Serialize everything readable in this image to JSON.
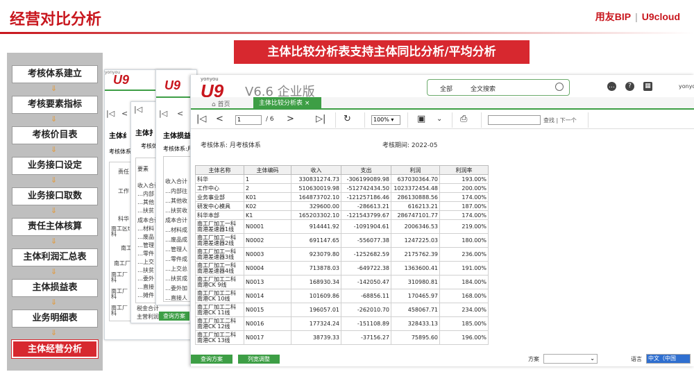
{
  "slide": {
    "title": "经营对比分析",
    "brand_left": "用友BIP",
    "brand_sep": "|",
    "brand_right": "U9cloud",
    "banner": "主体比较分析表支持主体同比分析/平均分析"
  },
  "process_steps": [
    "考核体系建立",
    "考核要素指标",
    "考核价目表",
    "业务接口设定",
    "业务接口取数",
    "责任主体核算",
    "主体利润汇总表",
    "主体损益表",
    "业务明细表",
    "主体经营分析"
  ],
  "arrow_glyph": "⇓",
  "bg_windows": {
    "w1": {
      "title_trunc": "主体纟",
      "sys_trunc": "考核体系",
      "label": "责任",
      "rows": [
        "工作",
        "科华",
        "南工区t\n科",
        "南工",
        "南工厂",
        "南工厂\n科",
        "南工厂\n科",
        "南工厂\n科"
      ]
    },
    "w2": {
      "title_trunc": "主体扌",
      "sys_trunc": "考核体",
      "label": "要素",
      "rows": [
        "收入合计",
        "…内部",
        "…其他",
        "…扶贫",
        "成本合计",
        "…材料",
        "…废品",
        "…管理",
        "…零件",
        "…上交",
        "…扶贫",
        "…委外",
        "…直接",
        "…摊件",
        "税金合计",
        "主营利润"
      ],
      "btn": "查询方案"
    },
    "w3": {
      "title_trunc": "主体损益",
      "sys_trunc": "考核体系:月",
      "rows": [
        "收入合计",
        "…内部往",
        "…其他收",
        "…扶贫收",
        "成本合计",
        "…材料成",
        "…废品成",
        "…管理人",
        "…零件成",
        "…上交总",
        "…扶贫成",
        "…委外加",
        "…直接人"
      ]
    }
  },
  "app": {
    "brand_small": "yonyou",
    "logo": "U9",
    "version": "V6.6 企业版",
    "search_scope": "全部",
    "search_placeholder": "全文搜索",
    "user_trunc": "yonyo",
    "tab_home": "首页",
    "tab_active": "主体比较分析表",
    "tab_close": "×",
    "page_current": "1",
    "page_total": "/ 6",
    "zoom": "100%",
    "find_label": "查找",
    "find_sep": "|",
    "next_label": "下一个",
    "system_label": "考核体系: 月考核体系",
    "period_label": "考核期间: 2022-05"
  },
  "table": {
    "headers": [
      "主体名称",
      "主体编码",
      "收入",
      "支出",
      "利润",
      "利润率"
    ],
    "rows": [
      [
        "科华",
        "1",
        "330831274.73",
        "-306199089.98",
        "637030364.70",
        "193.00%"
      ],
      [
        "工作中心",
        "2",
        "510630019.98",
        "-512742434.50",
        "1023372454.48",
        "200.00%"
      ],
      [
        "业务事业部",
        "K01",
        "164873702.10",
        "-121257186.46",
        "286130888.56",
        "174.00%"
      ],
      [
        "研发中心模具",
        "K02",
        "329600.00",
        "-286613.21",
        "616213.21",
        "187.00%"
      ],
      [
        "科华本部",
        "K1",
        "165203302.10",
        "-121543799.67",
        "286747101.77",
        "174.00%"
      ],
      [
        "南工厂加工一科\n南港差速器1线",
        "N0001",
        "914441.92",
        "-1091904.61",
        "2006346.53",
        "219.00%"
      ],
      [
        "南工厂加工一科\n南港差速器2线",
        "N0002",
        "691147.65",
        "-556077.38",
        "1247225.03",
        "180.00%"
      ],
      [
        "南工厂加工一科\n南港差速器3线",
        "N0003",
        "923079.80",
        "-1252682.59",
        "2175762.39",
        "236.00%"
      ],
      [
        "南工厂加工一科\n南港差速器4线",
        "N0004",
        "713878.03",
        "-649722.38",
        "1363600.41",
        "191.00%"
      ],
      [
        "南工厂加工二科\n南港CK 9线",
        "N0013",
        "168930.34",
        "-142050.47",
        "310980.81",
        "184.00%"
      ],
      [
        "南工厂加工二科\n南港CK 10线",
        "N0014",
        "101609.86",
        "-68856.11",
        "170465.97",
        "168.00%"
      ],
      [
        "南工厂加工二科\n南港CK 11线",
        "N0015",
        "196057.01",
        "-262010.70",
        "458067.71",
        "234.00%"
      ],
      [
        "南工厂加工二科\n南港CK 12线",
        "N0016",
        "177324.24",
        "-151108.89",
        "328433.13",
        "185.00%"
      ],
      [
        "南工厂加工二科\n南港CK 13线",
        "N0017",
        "38739.33",
        "-37156.27",
        "75895.60",
        "196.00%"
      ]
    ]
  },
  "footer": {
    "query_btn": "查询方案",
    "colwidth_btn": "列宽调整",
    "scheme_label": "方案",
    "lang_label": "语言",
    "lang_value": "中文（中国"
  },
  "colors": {
    "brand_red": "#c8161d",
    "banner_red": "#d7282f",
    "green": "#3d9e45",
    "panel_gray": "#bfbfbf"
  }
}
